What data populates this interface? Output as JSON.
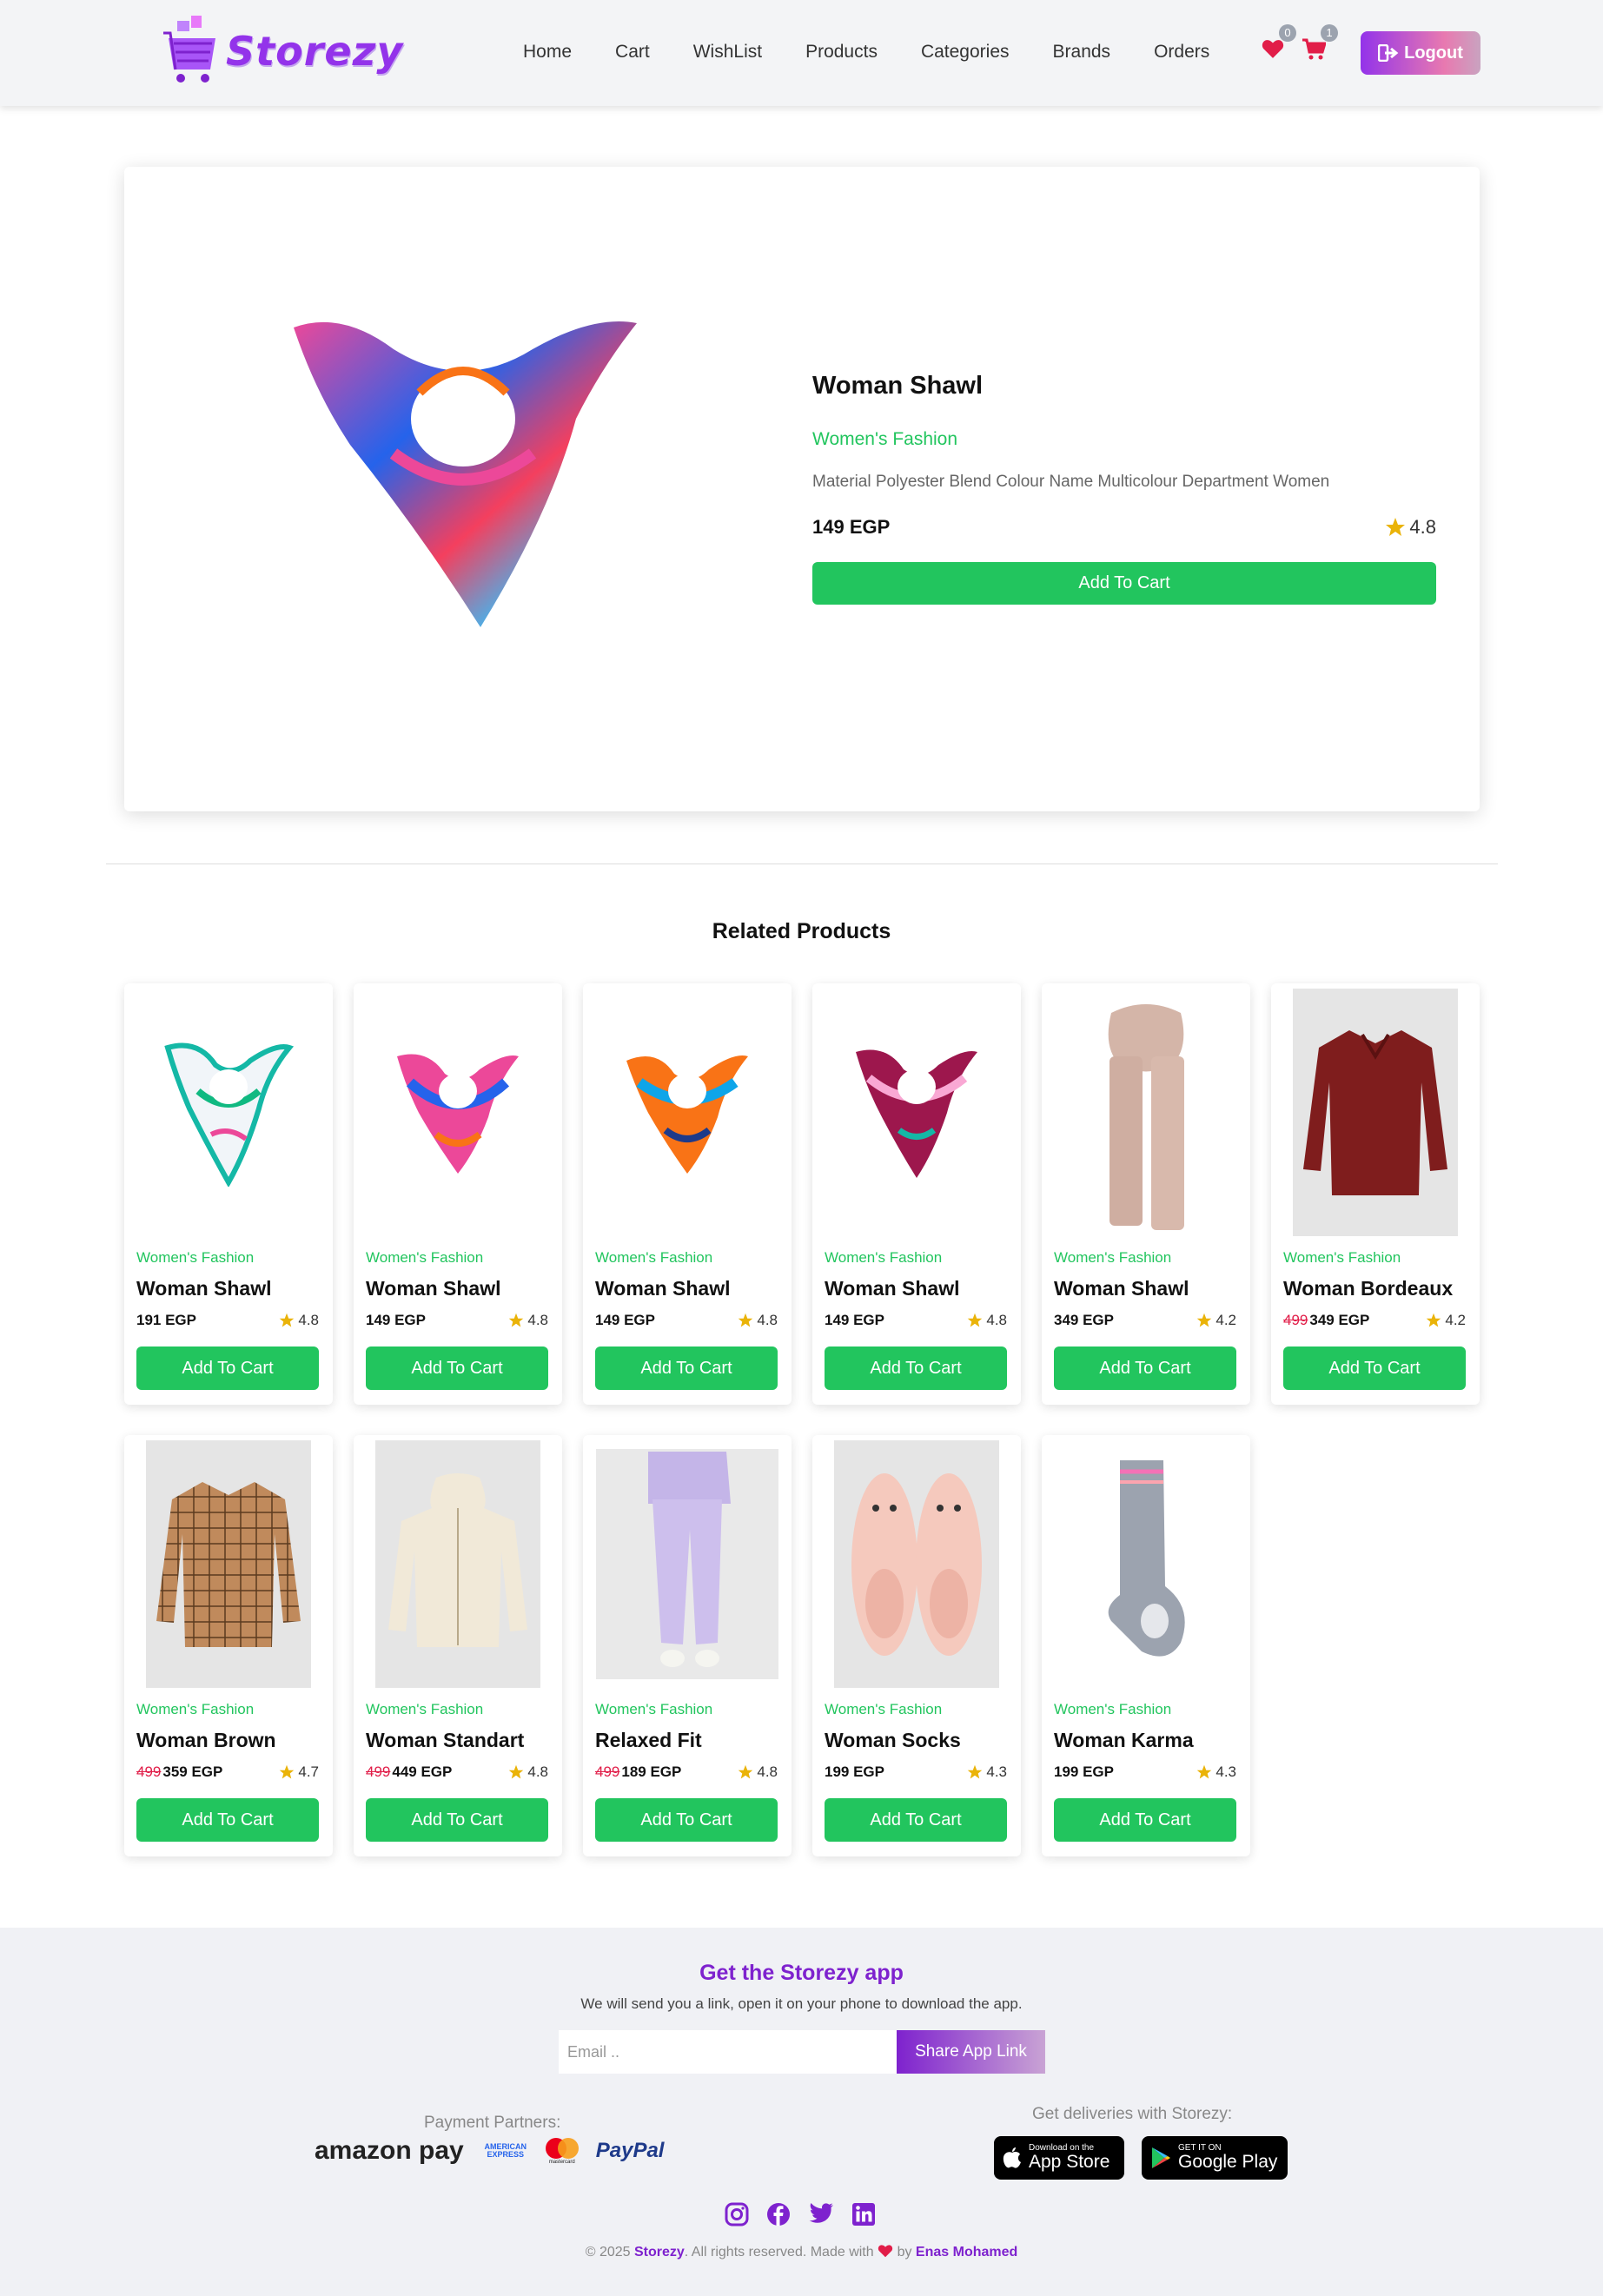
{
  "brand": {
    "name": "Storezy"
  },
  "nav": {
    "links": [
      "Home",
      "Cart",
      "WishList",
      "Products",
      "Categories",
      "Brands",
      "Orders"
    ],
    "wishlist_count": "0",
    "cart_count": "1",
    "logout_label": "Logout"
  },
  "product": {
    "title": "Woman Shawl",
    "category": "Women's Fashion",
    "description": "Material Polyester Blend Colour Name Multicolour Department Women",
    "price": "149 EGP",
    "rating": "4.8",
    "add_label": "Add To Cart"
  },
  "related": {
    "title": "Related Products",
    "items": [
      {
        "category": "Women's Fashion",
        "name": "Woman Shawl",
        "old_price": "",
        "price": "191 EGP",
        "rating": "4.8",
        "button": "Add To Cart",
        "image": "scarf-teal"
      },
      {
        "category": "Women's Fashion",
        "name": "Woman Shawl",
        "old_price": "",
        "price": "149 EGP",
        "rating": "4.8",
        "button": "Add To Cart",
        "image": "scarf-multi"
      },
      {
        "category": "Women's Fashion",
        "name": "Woman Shawl",
        "old_price": "",
        "price": "149 EGP",
        "rating": "4.8",
        "button": "Add To Cart",
        "image": "scarf-orange"
      },
      {
        "category": "Women's Fashion",
        "name": "Woman Shawl",
        "old_price": "",
        "price": "149 EGP",
        "rating": "4.8",
        "button": "Add To Cart",
        "image": "scarf-burgundy"
      },
      {
        "category": "Women's Fashion",
        "name": "Woman Shawl",
        "old_price": "",
        "price": "349 EGP",
        "rating": "4.2",
        "button": "Add To Cart",
        "image": "scarf-beige"
      },
      {
        "category": "Women's Fashion",
        "name": "Woman Bordeaux",
        "old_price": "499",
        "price": "349 EGP",
        "rating": "4.2",
        "button": "Add To Cart",
        "image": "shirt-bordeaux"
      },
      {
        "category": "Women's Fashion",
        "name": "Woman Brown",
        "old_price": "499",
        "price": "359 EGP",
        "rating": "4.7",
        "button": "Add To Cart",
        "image": "shirt-brown"
      },
      {
        "category": "Women's Fashion",
        "name": "Woman Standart",
        "old_price": "499",
        "price": "449 EGP",
        "rating": "4.8",
        "button": "Add To Cart",
        "image": "hoodie-cream"
      },
      {
        "category": "Women's Fashion",
        "name": "Relaxed Fit",
        "old_price": "499",
        "price": "189 EGP",
        "rating": "4.8",
        "button": "Add To Cart",
        "image": "joggers-lilac"
      },
      {
        "category": "Women's Fashion",
        "name": "Woman Socks",
        "old_price": "",
        "price": "199 EGP",
        "rating": "4.3",
        "button": "Add To Cart",
        "image": "socks-pink"
      },
      {
        "category": "Women's Fashion",
        "name": "Woman Karma",
        "old_price": "",
        "price": "199 EGP",
        "rating": "4.3",
        "button": "Add To Cart",
        "image": "sock-grey"
      }
    ]
  },
  "footer": {
    "title": "Get the Storezy app",
    "subtitle": "We will send you a link, open it on your phone to download the app.",
    "email_placeholder": "Email ..",
    "share_label": "Share App Link",
    "payment_label": "Payment Partners:",
    "payment_logos": [
      "amazon pay",
      "AMERICAN EXPRESS",
      "mastercard",
      "PayPal"
    ],
    "delivery_label": "Get deliveries with Storezy:",
    "app_store_small": "Download on the",
    "app_store_big": "App Store",
    "google_small": "GET IT ON",
    "google_big": "Google Play",
    "copyright_prefix": "© 2025",
    "copyright_brand": "Storezy",
    "copyright_mid": ". All rights reserved. Made with",
    "copyright_by": "by",
    "copyright_author": "Enas Mohamed"
  },
  "colors": {
    "accent": "#9333ea",
    "green": "#22c55e",
    "star": "#eab308",
    "heart": "#e11d48"
  }
}
